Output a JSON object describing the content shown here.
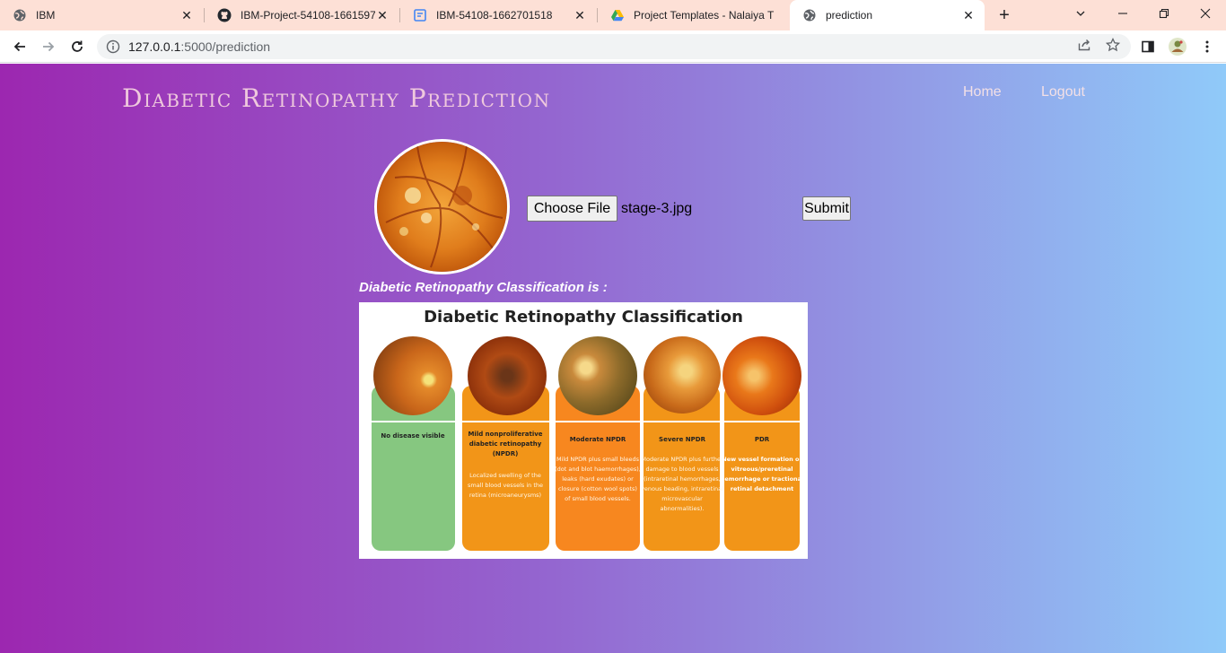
{
  "browser": {
    "tabs": [
      {
        "title": "IBM",
        "icon": "globe-icon",
        "active": false
      },
      {
        "title": "IBM-Project-54108-1661597",
        "icon": "github-icon",
        "active": false
      },
      {
        "title": "IBM-54108-1662701518",
        "icon": "docs-icon",
        "active": false
      },
      {
        "title": "Project Templates - Nalaiya T",
        "icon": "drive-icon",
        "active": false
      },
      {
        "title": "prediction",
        "icon": "globe-icon",
        "active": true
      }
    ],
    "url_host": "127.0.0.1",
    "url_path": ":5000/prediction"
  },
  "header": {
    "title": "Diabetic Retinopathy Prediction",
    "nav": {
      "home": "Home",
      "logout": "Logout"
    }
  },
  "upload": {
    "choose_label": "Choose File",
    "file_name": "stage-3.jpg",
    "submit_label": "Submit"
  },
  "result": {
    "label": "Diabetic Retinopathy Classification is :",
    "image_title": "Diabetic Retinopathy Classification",
    "stages": [
      {
        "name": "No disease visible",
        "description": "",
        "color": "#86c780"
      },
      {
        "name": "Mild nonproliferative diabetic retinopathy (NPDR)",
        "description": "Localized swelling of the small blood vessels in the retina (microaneurysms)",
        "color": "#f29518"
      },
      {
        "name": "Moderate NPDR",
        "description": "Mild NPDR plus small bleeds (dot and blot haemorrhages), leaks (hard exudates) or closure (cotton wool spots) of small blood vessels.",
        "color": "#f7871f"
      },
      {
        "name": "Severe NPDR",
        "description": "Moderate NPDR plus further damage to blood vessels (intraretinal hemorrhages, venous beading, intraretinal microvascular abnormalities).",
        "color": "#f29518"
      },
      {
        "name": "PDR",
        "description": "New vessel formation or vitreous/preretinal hemorrhage or tractional retinal detachment",
        "color": "#f29518"
      }
    ]
  },
  "colors": {
    "gradient_start": "#9c27b0",
    "gradient_end": "#90caf9",
    "tabstrip": "#fde0d6",
    "title_text": "#efc8dd"
  }
}
